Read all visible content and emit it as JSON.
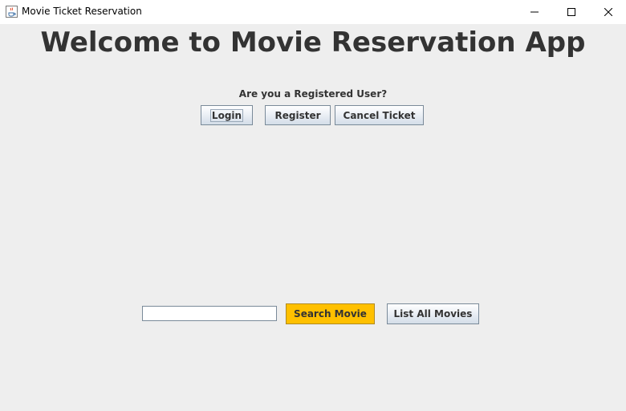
{
  "window": {
    "title": "Movie Ticket Reservation",
    "icons": {
      "app": "java-cup-icon",
      "minimize": "minimize-icon",
      "maximize": "maximize-icon",
      "close": "close-icon"
    }
  },
  "main": {
    "heading": "Welcome to Movie Reservation App",
    "question": "Are you a Registered User?",
    "buttons": {
      "login": "Login",
      "register": "Register",
      "cancel_ticket": "Cancel Ticket"
    }
  },
  "search": {
    "input_value": "",
    "search_button": "Search Movie",
    "list_button": "List All Movies"
  },
  "colors": {
    "background": "#eeeeee",
    "search_button": "#ffc000",
    "heading_text": "#333333"
  }
}
